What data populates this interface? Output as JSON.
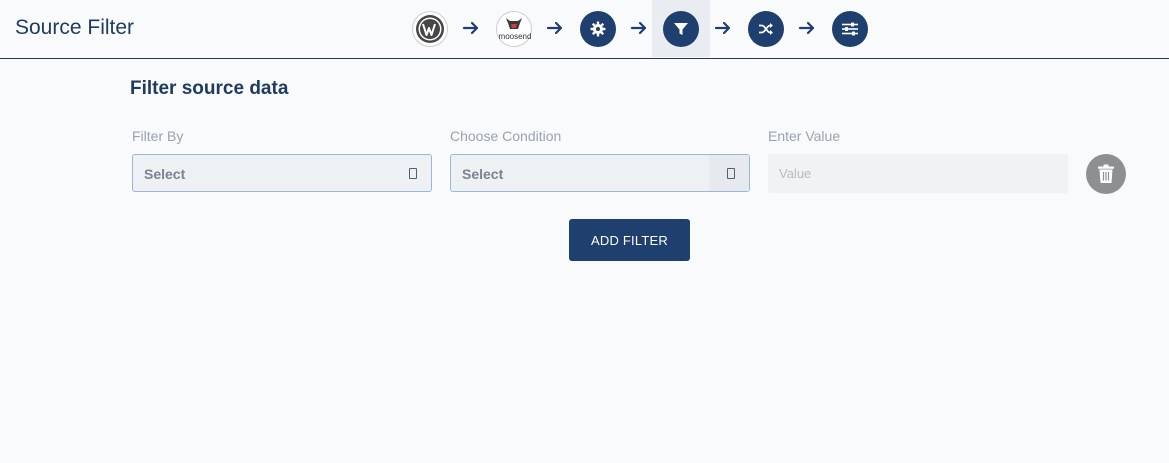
{
  "header": {
    "title": "Source Filter",
    "steps": [
      {
        "name": "wordpress-icon"
      },
      {
        "name": "moosend-logo",
        "label": "moosend"
      },
      {
        "name": "gear-icon"
      },
      {
        "name": "filter-icon",
        "active": true
      },
      {
        "name": "shuffle-icon"
      },
      {
        "name": "sliders-icon"
      }
    ]
  },
  "main": {
    "section_title": "Filter source data",
    "filter_by": {
      "label": "Filter By",
      "value": "Select"
    },
    "condition": {
      "label": "Choose Condition",
      "value": "Select"
    },
    "value": {
      "label": "Enter Value",
      "placeholder": "Value"
    },
    "add_filter_label": "ADD FILTER"
  },
  "colors": {
    "primary": "#1f3f6e",
    "active_step_bg": "#e9edf2",
    "delete_button": "#8d8f91"
  }
}
